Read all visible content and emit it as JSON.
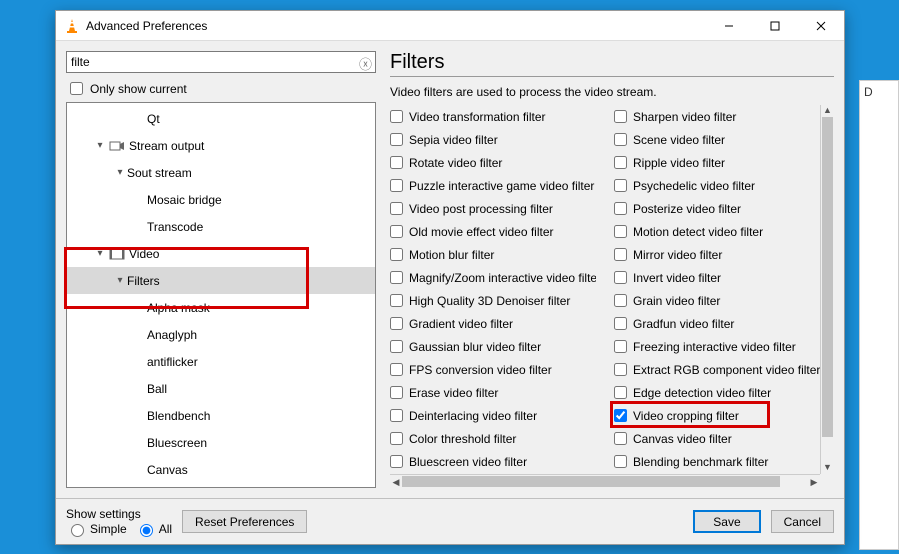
{
  "window": {
    "title": "Advanced Preferences"
  },
  "search": {
    "value": "filte"
  },
  "only_current_label": "Only show current",
  "tree": [
    {
      "label": "Qt",
      "indent": 3,
      "chev": "",
      "icon": ""
    },
    {
      "label": "Stream output",
      "indent": 1,
      "chev": "v",
      "icon": "stream"
    },
    {
      "label": "Sout stream",
      "indent": 2,
      "chev": "v",
      "icon": ""
    },
    {
      "label": "Mosaic bridge",
      "indent": 3,
      "chev": "",
      "icon": ""
    },
    {
      "label": "Transcode",
      "indent": 3,
      "chev": "",
      "icon": ""
    },
    {
      "label": "Video",
      "indent": 1,
      "chev": "v",
      "icon": "video"
    },
    {
      "label": "Filters",
      "indent": 2,
      "chev": "v",
      "icon": "",
      "selected": true
    },
    {
      "label": "Alpha mask",
      "indent": 3,
      "chev": "",
      "icon": ""
    },
    {
      "label": "Anaglyph",
      "indent": 3,
      "chev": "",
      "icon": ""
    },
    {
      "label": "antiflicker",
      "indent": 3,
      "chev": "",
      "icon": ""
    },
    {
      "label": "Ball",
      "indent": 3,
      "chev": "",
      "icon": ""
    },
    {
      "label": "Blendbench",
      "indent": 3,
      "chev": "",
      "icon": ""
    },
    {
      "label": "Bluescreen",
      "indent": 3,
      "chev": "",
      "icon": ""
    },
    {
      "label": "Canvas",
      "indent": 3,
      "chev": "",
      "icon": ""
    }
  ],
  "panel": {
    "title": "Filters",
    "desc": "Video filters are used to process the video stream."
  },
  "filters_col1": [
    {
      "label": "Video transformation filter",
      "checked": false
    },
    {
      "label": "Sepia video filter",
      "checked": false
    },
    {
      "label": "Rotate video filter",
      "checked": false
    },
    {
      "label": "Puzzle interactive game video filter",
      "checked": false
    },
    {
      "label": "Video post processing filter",
      "checked": false
    },
    {
      "label": "Old movie effect video filter",
      "checked": false
    },
    {
      "label": "Motion blur filter",
      "checked": false
    },
    {
      "label": "Magnify/Zoom interactive video filter",
      "checked": false
    },
    {
      "label": "High Quality 3D Denoiser filter",
      "checked": false
    },
    {
      "label": "Gradient video filter",
      "checked": false
    },
    {
      "label": "Gaussian blur video filter",
      "checked": false
    },
    {
      "label": "FPS conversion video filter",
      "checked": false
    },
    {
      "label": "Erase video filter",
      "checked": false
    },
    {
      "label": "Deinterlacing video filter",
      "checked": false
    },
    {
      "label": "Color threshold filter",
      "checked": false
    },
    {
      "label": "Bluescreen video filter",
      "checked": false
    }
  ],
  "filters_col2": [
    {
      "label": "Sharpen video filter",
      "checked": false
    },
    {
      "label": "Scene video filter",
      "checked": false
    },
    {
      "label": "Ripple video filter",
      "checked": false
    },
    {
      "label": "Psychedelic video filter",
      "checked": false
    },
    {
      "label": "Posterize video filter",
      "checked": false
    },
    {
      "label": "Motion detect video filter",
      "checked": false
    },
    {
      "label": "Mirror video filter",
      "checked": false
    },
    {
      "label": "Invert video filter",
      "checked": false
    },
    {
      "label": "Grain video filter",
      "checked": false
    },
    {
      "label": "Gradfun video filter",
      "checked": false
    },
    {
      "label": "Freezing interactive video filter",
      "checked": false
    },
    {
      "label": "Extract RGB component video filter",
      "checked": false
    },
    {
      "label": "Edge detection video filter",
      "checked": false
    },
    {
      "label": "Video cropping filter",
      "checked": true,
      "highlight": true
    },
    {
      "label": "Canvas video filter",
      "checked": false
    },
    {
      "label": "Blending benchmark filter",
      "checked": false
    }
  ],
  "footer": {
    "show_settings": "Show settings",
    "simple": "Simple",
    "all": "All",
    "reset": "Reset Preferences",
    "save": "Save",
    "cancel": "Cancel"
  }
}
